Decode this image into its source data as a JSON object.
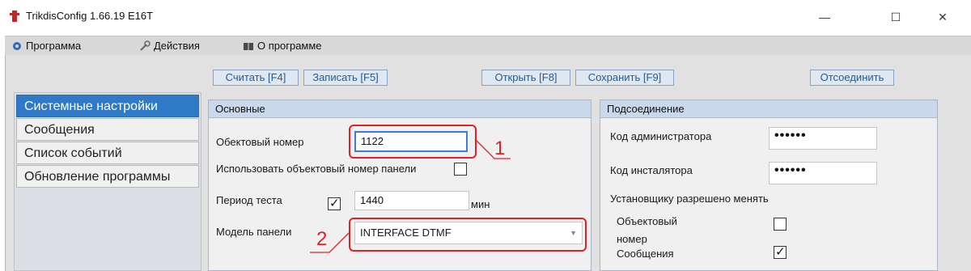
{
  "window": {
    "title": "TrikdisConfig 1.66.19   E16T",
    "minimize": "—",
    "maximize": "☐",
    "close": "✕"
  },
  "menu": {
    "items": [
      {
        "label": "Программа",
        "icon": "gear-icon"
      },
      {
        "label": "Действия",
        "icon": "wrench-icon"
      },
      {
        "label": "О программе",
        "icon": "book-icon"
      }
    ]
  },
  "toolbar": {
    "read": "Считать [F4]",
    "write": "Записать [F5]",
    "open": "Открыть [F8]",
    "save": "Сохранить [F9]",
    "disconnect": "Отсоединить"
  },
  "sidebar": {
    "items": [
      {
        "label": "Системные настройки",
        "active": true
      },
      {
        "label": "Сообщения",
        "active": false
      },
      {
        "label": "Список событий",
        "active": false
      },
      {
        "label": "Обновление программы",
        "active": false
      }
    ]
  },
  "basic": {
    "header": "Основные",
    "object_number_label": "Обектовый номер",
    "object_number_value": "1122",
    "use_panel_number_label": "Использовать объектовый номер панели",
    "use_panel_number_checked": false,
    "test_period_label": "Период теста",
    "test_period_checked": true,
    "test_period_value": "1440",
    "test_period_unit": "мин",
    "panel_model_label": "Модель панели",
    "panel_model_value": "INTERFACE DTMF"
  },
  "connection": {
    "header": "Подсоединение",
    "admin_code_label": "Код администратора",
    "admin_code_value": "••••••",
    "installer_code_label": "Код инсталятора",
    "installer_code_value": "••••••",
    "installer_allowed_label": "Установщику разрешено менять",
    "object_number_label": "Объектовый номер",
    "object_number_checked": false,
    "messages_label": "Сообщения",
    "messages_checked": true
  },
  "annotations": {
    "callout_1": "1",
    "callout_2": "2",
    "color": "#e32028"
  },
  "colors": {
    "accent": "#2f79c6",
    "panel_header": "#c9d8ea",
    "toolbar_text": "#1f5d9a"
  }
}
